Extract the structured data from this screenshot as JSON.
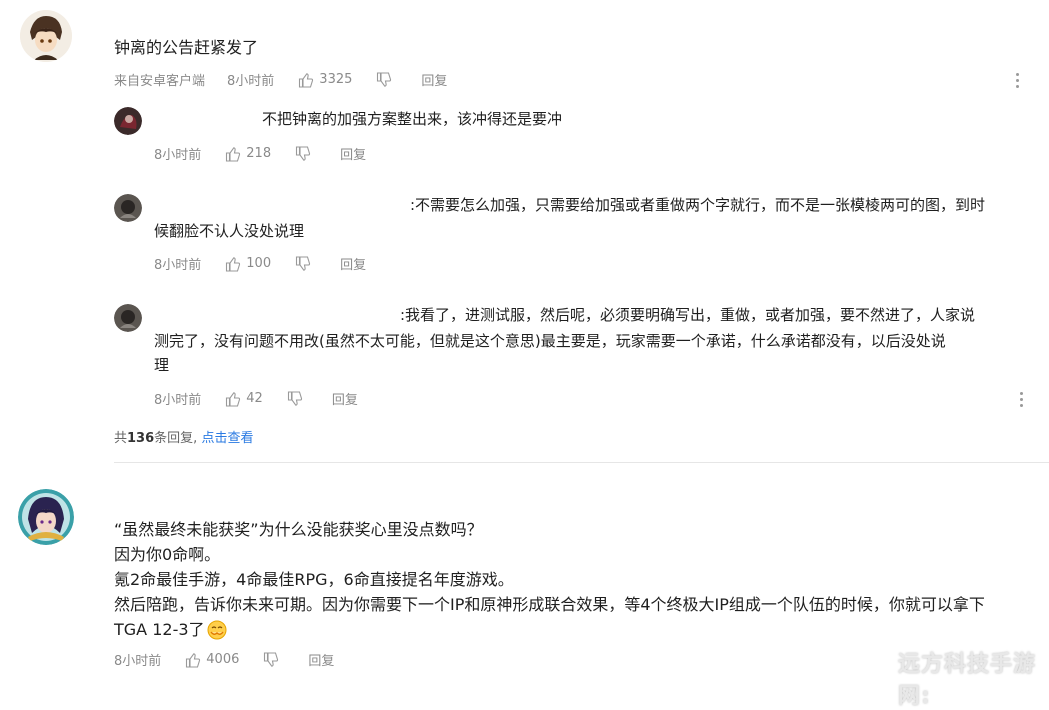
{
  "top_comment": {
    "text": "钟离的公告赶紧发了",
    "source": "来自安卓客户端",
    "time": "8小时前",
    "likes": "3325",
    "reply_label": "回复"
  },
  "replies": [
    {
      "text_lines": [
        "不把钟离的加强方案整出来，该冲得还是要冲"
      ],
      "time": "8小时前",
      "likes": "218",
      "reply_label": "回复"
    },
    {
      "text_lines": [
        ":不需要怎么加强，只需要给加强或者重做两个字就行，而不是一张模棱两可的图，到时",
        "候翻脸不认人没处说理"
      ],
      "time": "8小时前",
      "likes": "100",
      "reply_label": "回复"
    },
    {
      "text_lines": [
        ":我看了，进测试服，然后呢，必须要明确写出，重做，或者加强，要不然进了，人家说",
        "测完了，没有问题不用改(虽然不太可能，但就是这个意思)最主要是，玩家需要一个承诺，什么承诺都没有，以后没处说",
        "理"
      ],
      "time": "8小时前",
      "likes": "42",
      "reply_label": "回复"
    }
  ],
  "reply_summary": {
    "prefix": "共",
    "count": "136",
    "suffix": "条回复,",
    "link": "点击查看"
  },
  "second_comment": {
    "text_lines": [
      "“虽然最终未能获奖”为什么没能获奖心里没点数吗？",
      "因为你0命啊。",
      "氪2命最佳手游，4命最佳RPG，6命直接提名年度游戏。",
      "然后陪跑，告诉你未来可期。因为你需要下一个IP和原神形成联合效果，等4个终极大IP组成一个队伍的时候，你就可以拿下",
      "TGA 12-3了"
    ],
    "time": "8小时前",
    "likes": "4006",
    "reply_label": "回复"
  },
  "watermark": "远方科技手游网:",
  "colors": {
    "link": "#2a7ae2",
    "meta": "#8a8a8a",
    "text": "#1f1f1f"
  },
  "icons": [
    "thumbs-up-icon",
    "thumbs-down-icon",
    "more-vertical-icon",
    "emoji-icon"
  ]
}
